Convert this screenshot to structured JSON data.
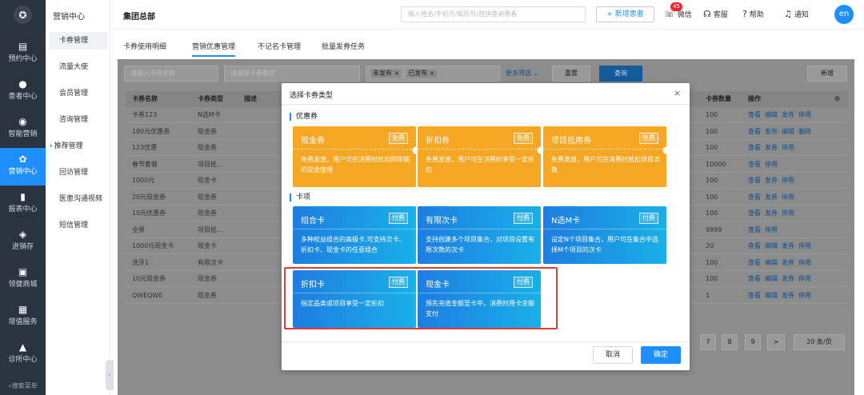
{
  "leftnav": {
    "items": [
      {
        "icon": "calendar-icon",
        "glyph": "▤",
        "label": "预约中心"
      },
      {
        "icon": "user-icon",
        "glyph": "●",
        "label": "患者中心"
      },
      {
        "icon": "smart-marketing-icon",
        "glyph": "◉",
        "label": "智能营销"
      },
      {
        "icon": "marketing-icon",
        "glyph": "✿",
        "label": "营销中心"
      },
      {
        "icon": "report-icon",
        "glyph": "▮",
        "label": "报表中心"
      },
      {
        "icon": "stock-icon",
        "glyph": "◈",
        "label": "进销存"
      },
      {
        "icon": "mall-icon",
        "glyph": "▣",
        "label": "领健商城"
      },
      {
        "icon": "service-icon",
        "glyph": "▦",
        "label": "增值服务"
      },
      {
        "icon": "clinic-icon",
        "glyph": "▲",
        "label": "诊所中心"
      }
    ],
    "search_label": "搜索菜单"
  },
  "subnav": {
    "title": "营销中心",
    "items": [
      "卡券管理",
      "流量大使",
      "会员管理",
      "咨询管理",
      "推荐管理",
      "回访管理",
      "医患沟通视频",
      "短信管理"
    ]
  },
  "header": {
    "org": "集团总部",
    "search_placeholder": "输入姓名/手机号/病历号/首拼查询患者",
    "new_patient": "+ 新增患者",
    "wechat": "微信",
    "wechat_badge": "45",
    "service": "客服",
    "help": "帮助",
    "notify": "通知",
    "avatar": "en"
  },
  "tabs": [
    "卡券使用明细",
    "营销优惠管理",
    "不记名卡管理",
    "批量发券任务"
  ],
  "filters": {
    "name_placeholder": "请输入卡券名称",
    "type_placeholder": "请选择卡券类型",
    "status_tags": [
      "未发布",
      "已发布"
    ],
    "more": "更多筛选",
    "reset": "重置",
    "query": "查询",
    "add": "新增"
  },
  "table": {
    "headers": [
      "卡券名称",
      "卡券类型",
      "描述",
      "卡券数量",
      "操作"
    ],
    "rows": [
      {
        "name": "卡券123",
        "type": "N选M卡",
        "qty": "100",
        "ops": [
          "查看",
          "编辑",
          "发券",
          "停用"
        ]
      },
      {
        "name": "180元优惠券",
        "type": "现金券",
        "qty": "100",
        "ops": [
          "查看",
          "发布",
          "编辑",
          "删除"
        ]
      },
      {
        "name": "123优惠",
        "type": "现金券",
        "qty": "100",
        "ops": [
          "查看",
          "发券",
          "停用"
        ]
      },
      {
        "name": "春节套餐",
        "type": "项目抵...",
        "qty": "10000",
        "ops": [
          "查看",
          "停用"
        ]
      },
      {
        "name": "1000元",
        "type": "现金卡",
        "qty": "100",
        "ops": [
          "查看",
          "发券",
          "停用"
        ]
      },
      {
        "name": "20元现金券",
        "type": "现金券",
        "qty": "100",
        "ops": [
          "查看",
          "发券",
          "停用"
        ]
      },
      {
        "name": "10元优惠券",
        "type": "现金券",
        "qty": "100",
        "ops": [
          "查看",
          "发券",
          "停用"
        ]
      },
      {
        "name": "全景",
        "type": "项目抵...",
        "qty": "9999",
        "ops": [
          "查看",
          "停用"
        ]
      },
      {
        "name": "1000元现金卡",
        "type": "现金卡",
        "qty": "20",
        "ops": [
          "查看",
          "编辑",
          "发券",
          "停用"
        ]
      },
      {
        "name": "洗牙1",
        "type": "有限次卡",
        "qty": "100",
        "ops": [
          "查看",
          "编辑",
          "发券",
          "停用"
        ]
      },
      {
        "name": "10元现金券",
        "type": "现金券",
        "qty": "100",
        "ops": [
          "查看",
          "编辑",
          "发券",
          "停用"
        ]
      },
      {
        "name": "QWEQWE",
        "type": "现金券",
        "qty": "1",
        "ops": [
          "查看",
          "编辑",
          "发券",
          "停用"
        ]
      }
    ]
  },
  "pager": {
    "pages": [
      "7",
      "8",
      "9"
    ],
    "next": ">",
    "size": "20 条/页"
  },
  "modal": {
    "title": "选择卡券类型",
    "close": "×",
    "section_coupon": "优惠券",
    "section_card": "卡项",
    "coupons": [
      {
        "name": "现金券",
        "badge": "免费",
        "desc": "免费发放，用户可在消费时抵扣同等额的现金使用"
      },
      {
        "name": "折扣券",
        "badge": "免费",
        "desc": "免费发放，用户可在消费时享受一定折扣"
      },
      {
        "name": "项目抵用券",
        "badge": "免费",
        "desc": "免费发放，用户可在消费时抵扣项目次数"
      }
    ],
    "cards": [
      {
        "name": "组合卡",
        "badge": "付费",
        "desc": "多种权益组合的高级卡,可支持次卡、折扣卡、现金卡的任意组合"
      },
      {
        "name": "有限次卡",
        "badge": "付费",
        "desc": "支持创建多个项目集合，对项目设置有限次数的次卡"
      },
      {
        "name": "N选M卡",
        "badge": "付费",
        "desc": "设定N个项目集合，用户可在集合中选择M个项目的次卡"
      },
      {
        "name": "折扣卡",
        "badge": "付费",
        "desc": "指定品类或项目享受一定折扣"
      },
      {
        "name": "现金卡",
        "badge": "付费",
        "desc": "预先充值金额至卡中，消费时用卡余额支付"
      }
    ],
    "cancel": "取消",
    "confirm": "确定"
  },
  "colors": {
    "accent": "#1f8fff",
    "coupon": "#f5a623",
    "highlight": "#e53935",
    "nav": "#2b3340"
  }
}
